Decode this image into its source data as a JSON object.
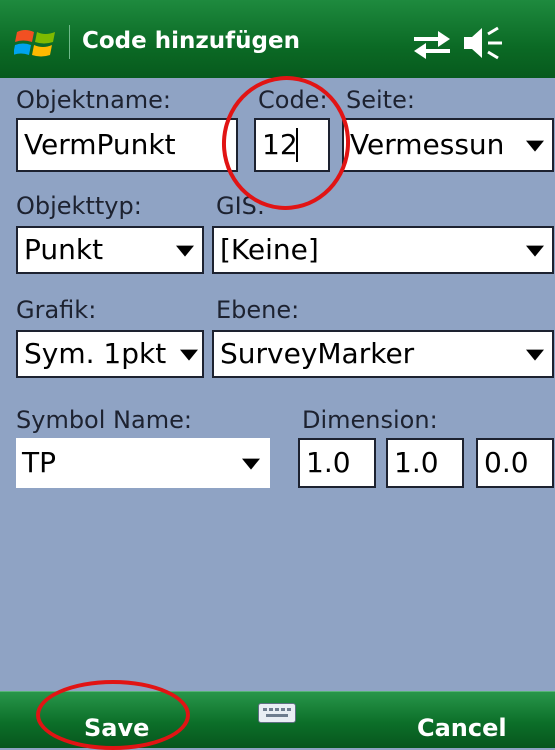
{
  "title_bar": {
    "title": "Code hinzufügen",
    "icons": [
      "windows-logo-icon",
      "sync-arrows-icon",
      "speaker-muted-icon"
    ]
  },
  "form": {
    "objektname": {
      "label": "Objektname:",
      "value": "VermPunkt"
    },
    "code": {
      "label": "Code:",
      "value": "12"
    },
    "seite": {
      "label": "Seite:",
      "value": "Vermessun"
    },
    "objekttyp": {
      "label": "Objekttyp:",
      "value": "Punkt"
    },
    "gis": {
      "label": "GIS:",
      "value": "[Keine]"
    },
    "grafik": {
      "label": "Grafik:",
      "value": "Sym. 1pkt"
    },
    "ebene": {
      "label": "Ebene:",
      "value": "SurveyMarker"
    },
    "symbol_name": {
      "label": "Symbol Name:",
      "value": "TP"
    },
    "dimension": {
      "label": "Dimension:",
      "values": [
        "1.0",
        "1.0",
        "0.0"
      ]
    }
  },
  "softkeys": {
    "left": "Save",
    "right": "Cancel",
    "center_icon": "keyboard-icon"
  },
  "colors": {
    "title_bar": "#0b6a25",
    "form_background": "#8fa3c4",
    "annotation_circle": "#e11414"
  }
}
